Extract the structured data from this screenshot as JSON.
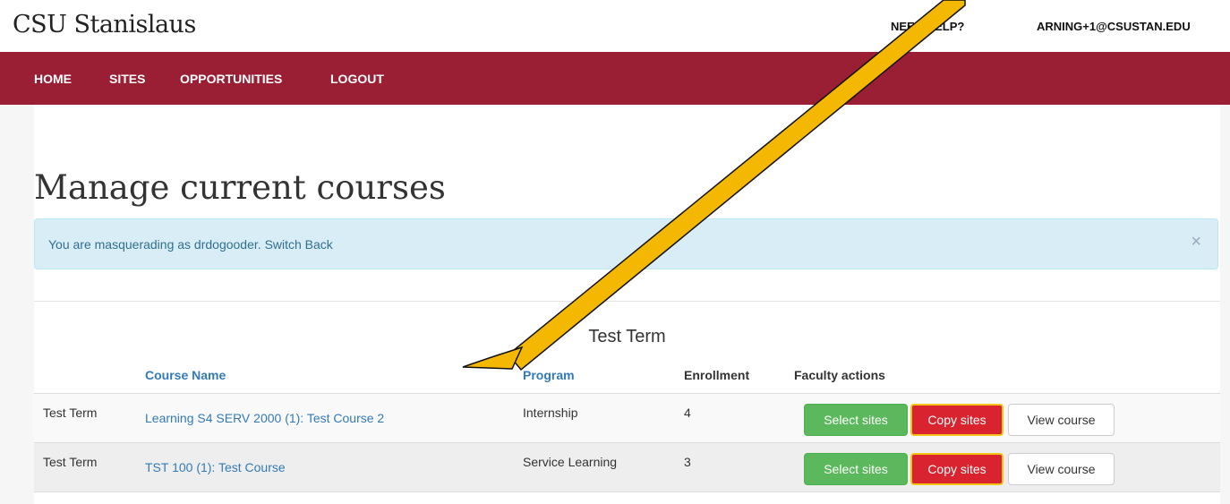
{
  "header": {
    "brand": "CSU Stanislaus",
    "help_label": "NEED HELP?",
    "user_email": "ARNING+1@CSUSTAN.EDU"
  },
  "nav": {
    "items": [
      "HOME",
      "SITES",
      "OPPORTUNITIES",
      "LOGOUT"
    ]
  },
  "page": {
    "title": "Manage current courses"
  },
  "alert": {
    "text": "You are masquerading as drdogooder.",
    "switch_back": "Switch Back",
    "close": "×"
  },
  "table": {
    "caption": "Test Term",
    "headers": {
      "course_name": "Course Name",
      "program": "Program",
      "enrollment": "Enrollment",
      "faculty_actions": "Faculty actions"
    },
    "rows": [
      {
        "term": "Test Term",
        "course_name": "Learning S4 SERV 2000 (1): Test Course 2",
        "program": "Internship",
        "enrollment": "4"
      },
      {
        "term": "Test Term",
        "course_name": "TST 100 (1): Test Course",
        "program": "Service Learning",
        "enrollment": "3"
      }
    ],
    "actions": {
      "select_sites": "Select sites",
      "copy_sites": "Copy sites",
      "view_course": "View course"
    }
  },
  "colors": {
    "nav_bg": "#9b1f34",
    "alert_bg": "#d9edf7",
    "link": "#337ab7",
    "btn_green": "#5cb85c",
    "btn_red": "#d9232f",
    "annotation_arrow": "#f5b800"
  },
  "annotation": {
    "icon": "annotation-arrow-icon"
  }
}
